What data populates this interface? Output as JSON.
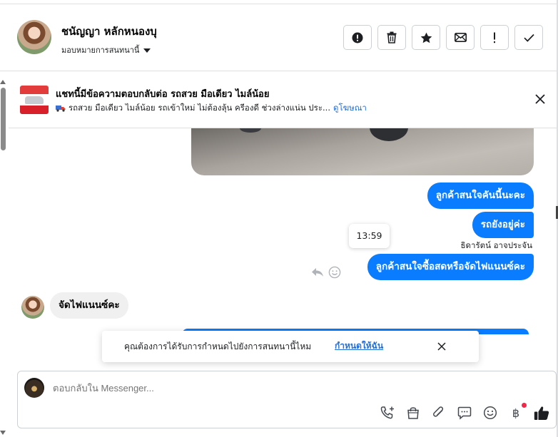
{
  "header": {
    "contact_name": "ชนัญญา หลักหนองบุ",
    "assign_label": "มอบหมายการสนทนานี้"
  },
  "actions": [
    {
      "icon": "alert-circle-icon"
    },
    {
      "icon": "trash-icon"
    },
    {
      "icon": "star-icon"
    },
    {
      "icon": "envelope-icon"
    },
    {
      "icon": "exclamation-icon"
    },
    {
      "icon": "check-icon"
    }
  ],
  "ad": {
    "title": "แชทนี้มีข้อความตอบกลับต่อ รถสวย มือเดียว ไมล์น้อย",
    "subtitle": "รถสวย มือเดียว ไมล์น้อย รถเข้าใหม่ ไม่ต้องลุ้น ครีองดี ช่วงล่างแน่น ประ...",
    "link": "ดูโฆษณา"
  },
  "messages": {
    "out_1": "ลูกค้าสนใจคันนี้นะคะ",
    "out_2": "รถยังอยู่ค่ะ",
    "timestamp": "13:59",
    "sender": "ธิดารัตน์ อาจประจัน",
    "out_3": "ลูกค้าสนใจซื้อสดหรือจัดไฟแนนซ์คะ",
    "in_1": "จัดไฟแนนซ์คะ"
  },
  "notice": {
    "text": "คุณต้องการได้รับการกำหนดไปยังการสนทนานี้ไหม",
    "link": "กำหนดให้ฉัน"
  },
  "composer": {
    "placeholder": "ตอบกลับใน Messenger...",
    "currency_symbol": "฿"
  },
  "colors": {
    "accent": "#0a7cff",
    "link": "#216fdb",
    "incoming_bubble": "#f0f0f0",
    "badge_dot": "#f02849"
  }
}
